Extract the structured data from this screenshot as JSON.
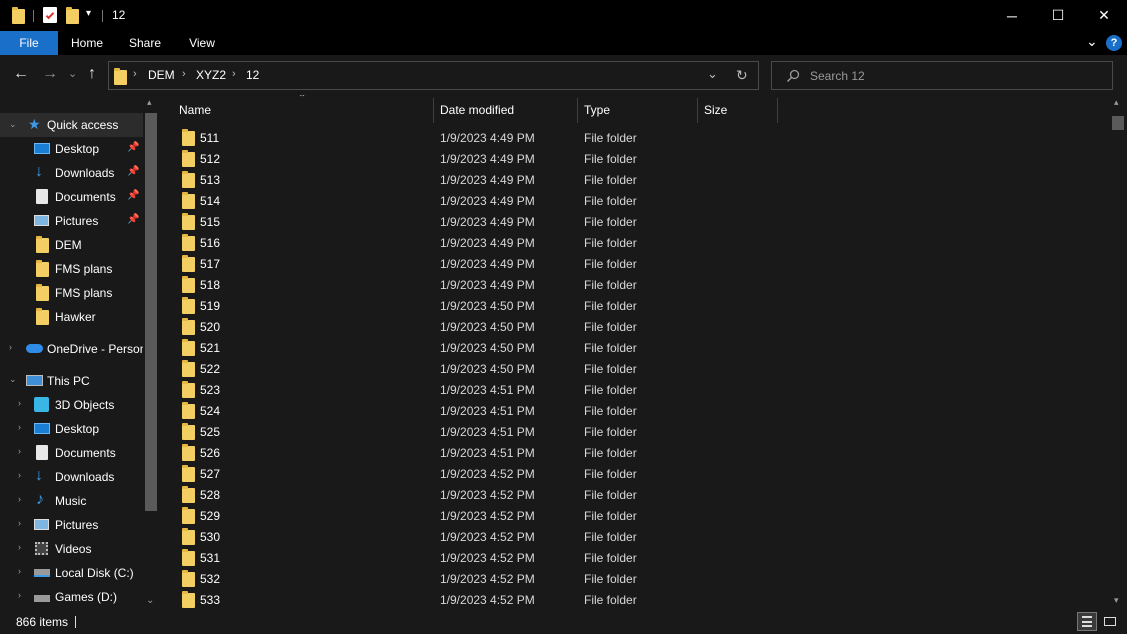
{
  "window": {
    "title": "12",
    "minimize_glyph": "─",
    "maximize_glyph": "☐",
    "close_glyph": "✕"
  },
  "ribbon": {
    "tabs": [
      "File",
      "Home",
      "Share",
      "View"
    ],
    "help_glyph": "?",
    "collapse_glyph": "⌄"
  },
  "address": {
    "breadcrumbs": [
      "DEM",
      "XYZ2",
      "12"
    ],
    "separator": "›",
    "dropdown_glyph": "⌄",
    "refresh_glyph": "↻"
  },
  "nav_buttons": {
    "back": "←",
    "forward": "→",
    "recent": "⌄",
    "up": "↑"
  },
  "search": {
    "placeholder": "Search 12"
  },
  "nav_pane": {
    "quick_access": {
      "label": "Quick access",
      "items": [
        {
          "label": "Desktop",
          "icon": "desktop-icon",
          "pinned": true
        },
        {
          "label": "Downloads",
          "icon": "download-icon",
          "pinned": true
        },
        {
          "label": "Documents",
          "icon": "documents-icon",
          "pinned": true
        },
        {
          "label": "Pictures",
          "icon": "pictures-icon",
          "pinned": true
        },
        {
          "label": "DEM",
          "icon": "folder-icon",
          "pinned": false
        },
        {
          "label": "FMS plans",
          "icon": "folder-icon",
          "pinned": false
        },
        {
          "label": "FMS plans",
          "icon": "folder-icon",
          "pinned": false
        },
        {
          "label": "Hawker",
          "icon": "folder-icon",
          "pinned": false
        }
      ]
    },
    "onedrive": "OneDrive - Person",
    "this_pc": {
      "label": "This PC",
      "items": [
        {
          "label": "3D Objects",
          "icon": "3d-objects-icon"
        },
        {
          "label": "Desktop",
          "icon": "desktop-icon"
        },
        {
          "label": "Documents",
          "icon": "documents-icon"
        },
        {
          "label": "Downloads",
          "icon": "download-icon"
        },
        {
          "label": "Music",
          "icon": "music-icon"
        },
        {
          "label": "Pictures",
          "icon": "pictures-icon"
        },
        {
          "label": "Videos",
          "icon": "videos-icon"
        },
        {
          "label": "Local Disk (C:)",
          "icon": "drive-icon"
        },
        {
          "label": "Games (D:)",
          "icon": "drive-icon"
        }
      ]
    }
  },
  "columns": {
    "name": "Name",
    "date": "Date modified",
    "type": "Type",
    "size": "Size"
  },
  "files": [
    {
      "name": "511",
      "date": "1/9/2023 4:49 PM",
      "type": "File folder"
    },
    {
      "name": "512",
      "date": "1/9/2023 4:49 PM",
      "type": "File folder"
    },
    {
      "name": "513",
      "date": "1/9/2023 4:49 PM",
      "type": "File folder"
    },
    {
      "name": "514",
      "date": "1/9/2023 4:49 PM",
      "type": "File folder"
    },
    {
      "name": "515",
      "date": "1/9/2023 4:49 PM",
      "type": "File folder"
    },
    {
      "name": "516",
      "date": "1/9/2023 4:49 PM",
      "type": "File folder"
    },
    {
      "name": "517",
      "date": "1/9/2023 4:49 PM",
      "type": "File folder"
    },
    {
      "name": "518",
      "date": "1/9/2023 4:49 PM",
      "type": "File folder"
    },
    {
      "name": "519",
      "date": "1/9/2023 4:50 PM",
      "type": "File folder"
    },
    {
      "name": "520",
      "date": "1/9/2023 4:50 PM",
      "type": "File folder"
    },
    {
      "name": "521",
      "date": "1/9/2023 4:50 PM",
      "type": "File folder"
    },
    {
      "name": "522",
      "date": "1/9/2023 4:50 PM",
      "type": "File folder"
    },
    {
      "name": "523",
      "date": "1/9/2023 4:51 PM",
      "type": "File folder"
    },
    {
      "name": "524",
      "date": "1/9/2023 4:51 PM",
      "type": "File folder"
    },
    {
      "name": "525",
      "date": "1/9/2023 4:51 PM",
      "type": "File folder"
    },
    {
      "name": "526",
      "date": "1/9/2023 4:51 PM",
      "type": "File folder"
    },
    {
      "name": "527",
      "date": "1/9/2023 4:52 PM",
      "type": "File folder"
    },
    {
      "name": "528",
      "date": "1/9/2023 4:52 PM",
      "type": "File folder"
    },
    {
      "name": "529",
      "date": "1/9/2023 4:52 PM",
      "type": "File folder"
    },
    {
      "name": "530",
      "date": "1/9/2023 4:52 PM",
      "type": "File folder"
    },
    {
      "name": "531",
      "date": "1/9/2023 4:52 PM",
      "type": "File folder"
    },
    {
      "name": "532",
      "date": "1/9/2023 4:52 PM",
      "type": "File folder"
    },
    {
      "name": "533",
      "date": "1/9/2023 4:52 PM",
      "type": "File folder"
    }
  ],
  "status": {
    "item_count": "866 items"
  },
  "colors": {
    "accent": "#1a6fc9",
    "folder": "#f3cf63",
    "background": "#191919"
  }
}
